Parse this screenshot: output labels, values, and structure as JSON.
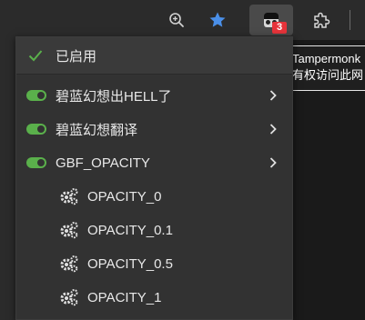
{
  "toolbar": {
    "zoom_icon": "zoom-in-icon",
    "star_icon": "star-icon",
    "extension_icon": "puzzle-icon",
    "tampermonkey_badge": "3",
    "star_color": "#4a8fe8",
    "badge_color": "#e6333a"
  },
  "tooltip": {
    "line1": "Tampermonk",
    "line2": "有权访问此网"
  },
  "menu": {
    "header_label": "已启用",
    "check_color": "#5ab04b",
    "scripts": [
      {
        "label": "碧蓝幻想出HELL了",
        "enabled": true
      },
      {
        "label": "碧蓝幻想翻译",
        "enabled": true
      },
      {
        "label": "GBF_OPACITY",
        "enabled": true
      }
    ],
    "sub_items": [
      {
        "label": "OPACITY_0"
      },
      {
        "label": "OPACITY_0.1"
      },
      {
        "label": "OPACITY_0.5"
      },
      {
        "label": "OPACITY_1"
      }
    ]
  }
}
